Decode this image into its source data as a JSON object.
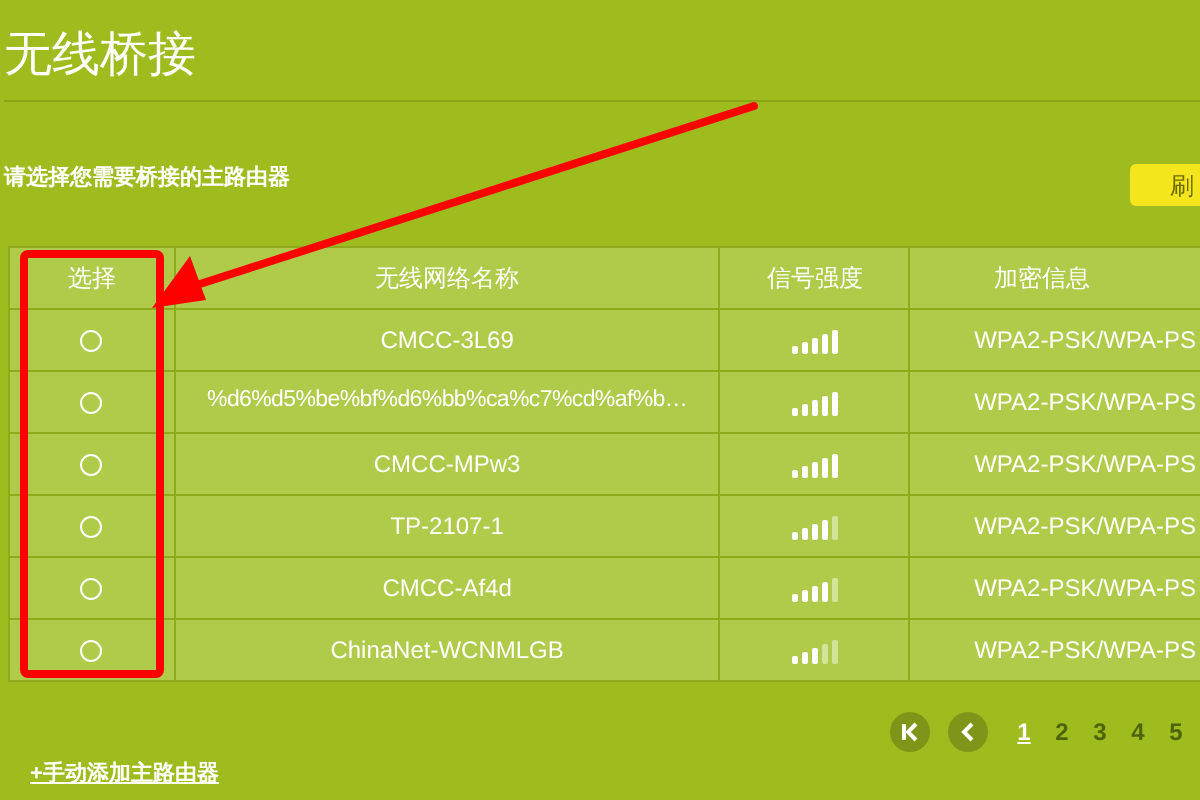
{
  "title": "无线桥接",
  "instruction": "请选择您需要桥接的主路由器",
  "refresh_button": {
    "label": "刷"
  },
  "table": {
    "columns": [
      "选择",
      "无线网络名称",
      "信号强度",
      "加密信息"
    ],
    "rows": [
      {
        "selected": false,
        "ssid": "CMCC-3L69",
        "kind": "strong",
        "security": "WPA2-PSK/WPA-PS"
      },
      {
        "selected": false,
        "ssid": "%d6%d5%be%bf%d6%bb%ca%c7%cd%af%b…",
        "kind": "strong",
        "security": "WPA2-PSK/WPA-PS"
      },
      {
        "selected": false,
        "ssid": "CMCC-MPw3",
        "kind": "strong",
        "security": "WPA2-PSK/WPA-PS"
      },
      {
        "selected": false,
        "ssid": "TP-2107-1",
        "kind": "good",
        "security": "WPA2-PSK/WPA-PS"
      },
      {
        "selected": false,
        "ssid": "CMCC-Af4d",
        "kind": "good",
        "security": "WPA2-PSK/WPA-PS"
      },
      {
        "selected": false,
        "ssid": "ChinaNet-WCNMLGB",
        "kind": "fair",
        "security": "WPA2-PSK/WPA-PS"
      }
    ]
  },
  "pagination": {
    "pages": [
      {
        "label": "1",
        "selected": true
      },
      {
        "label": "2",
        "selected": false
      },
      {
        "label": "3",
        "selected": false
      },
      {
        "label": "4",
        "selected": false
      },
      {
        "label": "5",
        "selected": false
      }
    ]
  },
  "add_link": "+手动添加主路由器"
}
